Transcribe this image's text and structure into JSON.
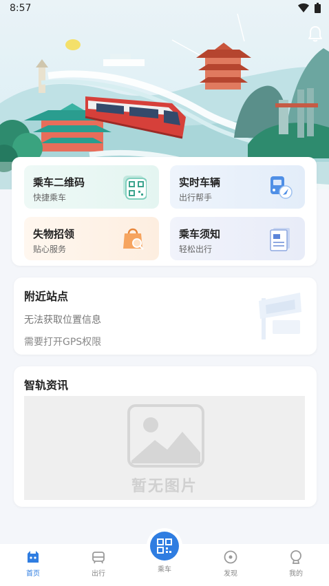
{
  "status_bar": {
    "time": "8:57",
    "icons": [
      "wifi-icon",
      "battery-icon"
    ]
  },
  "header": {
    "bell_icon": "bell-icon"
  },
  "services": [
    {
      "title": "乘车二维码",
      "subtitle": "快捷乘车",
      "icon": "qr-code-icon"
    },
    {
      "title": "实时车辆",
      "subtitle": "出行帮手",
      "icon": "bus-locate-icon"
    },
    {
      "title": "失物招领",
      "subtitle": "贴心服务",
      "icon": "shopping-bag-icon"
    },
    {
      "title": "乘车须知",
      "subtitle": "轻松出行",
      "icon": "document-icon"
    }
  ],
  "nearby": {
    "title": "附近站点",
    "message": "无法获取位置信息",
    "hint": "需要打开GPS权限"
  },
  "news": {
    "title": "智轨资讯",
    "placeholder_text": "暂无图片"
  },
  "tabbar": [
    {
      "label": "首页",
      "icon": "home-icon",
      "active": true
    },
    {
      "label": "出行",
      "icon": "tram-icon",
      "active": false
    },
    {
      "label": "乘车",
      "icon": "qr-scan-icon",
      "active": false
    },
    {
      "label": "发现",
      "icon": "compass-icon",
      "active": false
    },
    {
      "label": "我的",
      "icon": "profile-icon",
      "active": false
    }
  ],
  "colors": {
    "accent": "#2f7de1",
    "train_red": "#d6403a",
    "page_bg": "#f4f6fa"
  }
}
